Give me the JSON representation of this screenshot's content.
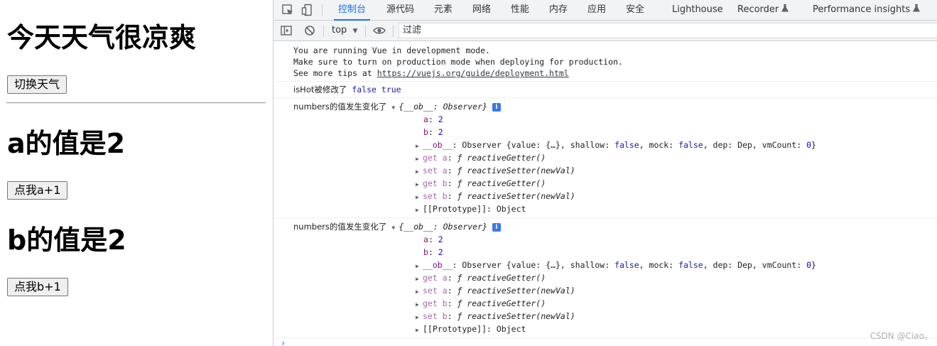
{
  "app": {
    "weather_heading": "今天天气很凉爽",
    "switch_button": "切换天气",
    "a_heading": "a的值是2",
    "a_button": "点我a+1",
    "b_heading": "b的值是2",
    "b_button": "点我b+1"
  },
  "devtools": {
    "tabs": [
      "控制台",
      "源代码",
      "元素",
      "网络",
      "性能",
      "内存",
      "应用",
      "安全",
      "Lighthouse",
      "Recorder",
      "Performance insights"
    ],
    "active_tab": "控制台",
    "context": "top",
    "filter_placeholder": "过滤",
    "console": {
      "vue_msg_1": "You are running Vue in development mode.",
      "vue_msg_2": "Make sure to turn on production mode when deploying for production.",
      "vue_msg_3_prefix": "See more tips at ",
      "vue_msg_3_link": "https://vuejs.org/guide/deployment.html",
      "ishot_label": "isHot被修改了",
      "ishot_new": "false",
      "ishot_old": "true",
      "numbers_label": "numbers的值发生变化了",
      "obj_summary": "{__ob__: Observer}",
      "prop_a": "a",
      "val_a": "2",
      "prop_b": "b",
      "val_b": "2",
      "ob_key": "__ob__",
      "ob_value_prefix": "Observer {value: {…}, shallow: ",
      "ob_shallow": "false",
      "ob_mock_label": ", mock: ",
      "ob_mock": "false",
      "ob_dep_label": ", dep: Dep, vmCount: ",
      "ob_vmcount": "0",
      "ob_close": "}",
      "get_a": "get a",
      "set_a": "set a",
      "get_b": "get b",
      "set_b": "set b",
      "f_symbol": "ƒ",
      "getter_fn": "reactiveGetter()",
      "setter_fn": "reactiveSetter(newVal)",
      "proto_key": "[[Prototype]]",
      "proto_value": "Object"
    }
  },
  "watermark": "CSDN @Ciao。",
  "colors": {
    "accent": "#1a73e8",
    "keyword": "#1a1aa6",
    "property": "#881280",
    "number": "#1c00cf"
  }
}
